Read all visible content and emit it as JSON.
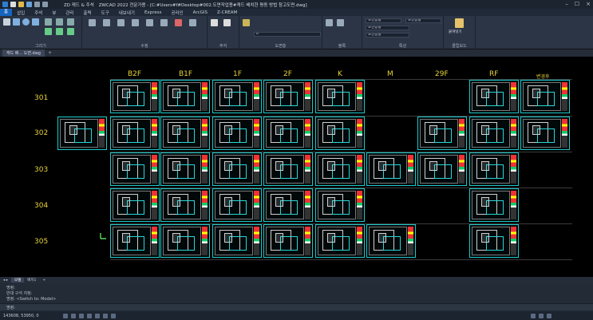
{
  "titlebar": {
    "tab_label": "ZD 캐드 & 주석",
    "app_title": "ZWCAD 2022 전문가용 - [C:#Users#f#Desktop#002.도면작업용#캐드 배치한 평동 방법 참고도면.dwg]"
  },
  "ribbon": {
    "tabs": [
      "홈",
      "삽입",
      "주석",
      "뷰",
      "관리",
      "출력",
      "도구",
      "내보내기",
      "Express",
      "공라인",
      "ArcGIS",
      "Z-CREAM"
    ],
    "groups": [
      "그리기",
      "수정",
      "주석",
      "도면층",
      "블록",
      "특성",
      "클립보드"
    ],
    "layer_combo": "0",
    "color_combo": "도면층별",
    "linetype_combo": "도면층별",
    "lineweight_combo": "도면층별",
    "paste_label": "붙여넣기"
  },
  "doc_tabs": [
    "캐드 배... 도면.dwg"
  ],
  "drawing": {
    "columns": [
      "B2F",
      "B1F",
      "1F",
      "2F",
      "K",
      "M",
      "29F",
      "RF",
      "변경후"
    ],
    "rows": [
      "301",
      "302",
      "303",
      "304",
      "305"
    ]
  },
  "layout_tabs": [
    "모델",
    "배치1",
    "+"
  ],
  "command": {
    "lines": [
      "명령:",
      "반대 구석 지정:",
      "명령: <Switch to: Model>",
      "명령:"
    ]
  },
  "status": {
    "coords": "143608, 53950, 0"
  }
}
